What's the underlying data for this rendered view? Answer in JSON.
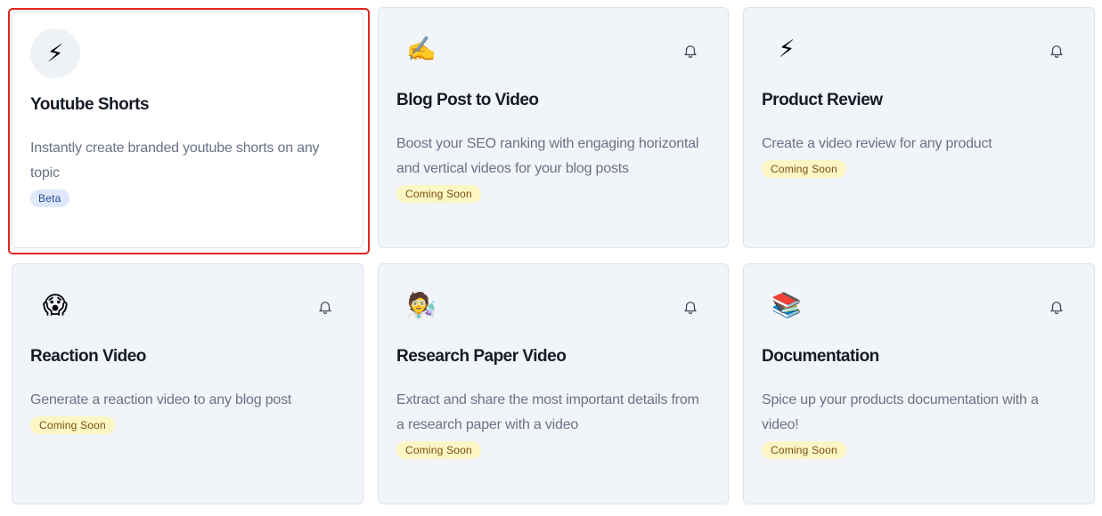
{
  "cards": [
    {
      "icon": "⚡",
      "icon_name": "lightning-icon",
      "title": "Youtube Shorts",
      "description": "Instantly create branded youtube shorts on any topic",
      "badge": "Beta",
      "selected": true,
      "has_bell": false
    },
    {
      "icon": "✍️",
      "icon_name": "writing-hand-icon",
      "title": "Blog Post to Video",
      "description": "Boost your SEO ranking with engaging horizontal and vertical videos for your blog posts",
      "badge": "Coming Soon",
      "selected": false,
      "has_bell": true
    },
    {
      "icon": "⚡",
      "icon_name": "lightning-icon",
      "title": "Product Review",
      "description": "Create a video review for any product",
      "badge": "Coming Soon",
      "selected": false,
      "has_bell": true
    },
    {
      "icon": "😱",
      "icon_name": "screaming-face-icon",
      "title": "Reaction Video",
      "description": "Generate a reaction video to any blog post",
      "badge": "Coming Soon",
      "selected": false,
      "has_bell": true
    },
    {
      "icon": "🧑‍🔬",
      "icon_name": "scientist-icon",
      "title": "Research Paper Video",
      "description": "Extract and share the most important details from a research paper with a video",
      "badge": "Coming Soon",
      "selected": false,
      "has_bell": true
    },
    {
      "icon": "📚",
      "icon_name": "books-icon",
      "title": "Documentation",
      "description": "Spice up your products documentation with a video!",
      "badge": "Coming Soon",
      "selected": false,
      "has_bell": true
    }
  ],
  "colors": {
    "selection_outline": "#e3261f",
    "card_bg": "#f1f4f9",
    "badge_soon_bg": "#fcf6c5",
    "badge_beta_bg": "#dfe8fa"
  }
}
